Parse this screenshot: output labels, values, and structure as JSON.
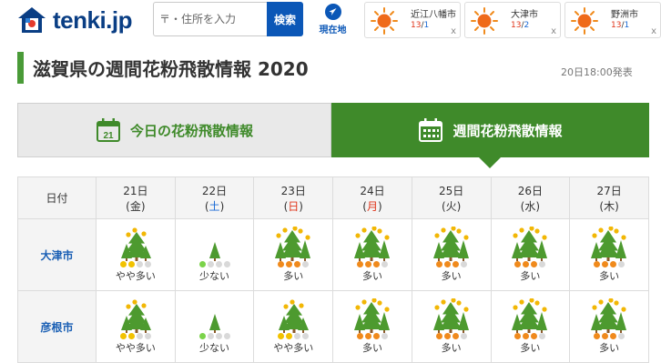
{
  "header": {
    "logo_text": "tenki.jp",
    "search_placeholder": "〒・住所を入力",
    "search_button": "検索",
    "locate_label": "現在地",
    "cities": [
      {
        "name": "近江八幡市",
        "high": "13",
        "low": "1",
        "weather_icon": "sun-icon"
      },
      {
        "name": "大津市",
        "high": "13",
        "low": "2",
        "weather_icon": "sun-icon"
      },
      {
        "name": "野洲市",
        "high": "13",
        "low": "1",
        "weather_icon": "sun-icon"
      }
    ],
    "close_glyph": "x",
    "temp_separator": "/"
  },
  "page": {
    "title": "滋賀県の週間花粉飛散情報 2020",
    "updated": "20日18:00発表"
  },
  "tabs": {
    "today": "今日の花粉飛散情報",
    "today_icon_day": "21",
    "week": "週間花粉飛散情報"
  },
  "table": {
    "header_label": "日付",
    "days": [
      {
        "date": "21日",
        "dow": "金",
        "dow_type": "weekday"
      },
      {
        "date": "22日",
        "dow": "土",
        "dow_type": "sat"
      },
      {
        "date": "23日",
        "dow": "日",
        "dow_type": "sun"
      },
      {
        "date": "24日",
        "dow": "月",
        "dow_type": "holiday"
      },
      {
        "date": "25日",
        "dow": "火",
        "dow_type": "weekday"
      },
      {
        "date": "26日",
        "dow": "水",
        "dow_type": "weekday"
      },
      {
        "date": "27日",
        "dow": "木",
        "dow_type": "weekday"
      }
    ],
    "rows": [
      {
        "city": "大津市",
        "levels": [
          {
            "label": "やや多い",
            "level": 2
          },
          {
            "label": "少ない",
            "level": 1
          },
          {
            "label": "多い",
            "level": 3
          },
          {
            "label": "多い",
            "level": 3
          },
          {
            "label": "多い",
            "level": 3
          },
          {
            "label": "多い",
            "level": 3
          },
          {
            "label": "多い",
            "level": 3
          }
        ]
      },
      {
        "city": "彦根市",
        "levels": [
          {
            "label": "やや多い",
            "level": 2
          },
          {
            "label": "少ない",
            "level": 1
          },
          {
            "label": "やや多い",
            "level": 2
          },
          {
            "label": "多い",
            "level": 3
          },
          {
            "label": "多い",
            "level": 3
          },
          {
            "label": "多い",
            "level": 3
          },
          {
            "label": "多い",
            "level": 3
          }
        ]
      }
    ]
  },
  "colors": {
    "green": "#3f8a2a",
    "brand_blue": "#0b57b7",
    "level1": "#7bd34a",
    "level2": "#f2c200",
    "level3": "#f08a1c",
    "level_off": "#d9d9d9"
  }
}
